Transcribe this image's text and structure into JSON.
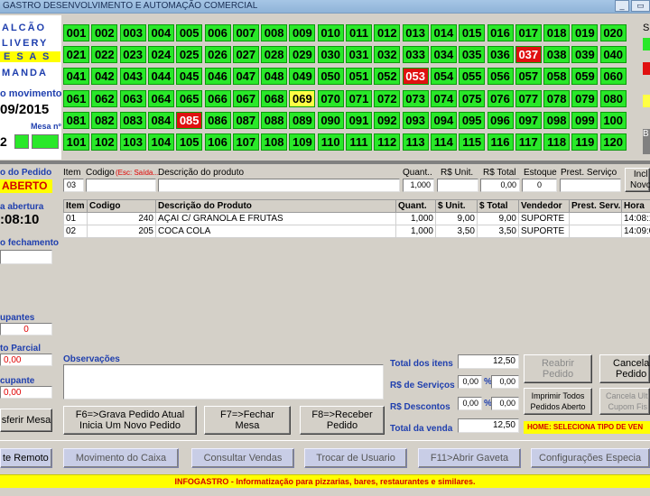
{
  "window": {
    "title": "GASTRO DESENVOLVIMENTO E AUTOMAÇÃO COMERCIAL",
    "minimize": "_"
  },
  "left_menu": {
    "balcao": "ALCÃO",
    "delivery": "LIVERY",
    "mesas": "E S A S",
    "comanda": "MANDA",
    "movimento_label": "o movimento",
    "movimento_date": "09/2015",
    "mesa_label": "Mesa nº",
    "mesa_value": "2"
  },
  "tables": [
    [
      "001",
      "002",
      "003",
      "004",
      "005",
      "006",
      "007",
      "008",
      "009",
      "010",
      "011",
      "012",
      "013",
      "014",
      "015",
      "016",
      "017",
      "018",
      "019",
      "020"
    ],
    [
      "021",
      "022",
      "023",
      "024",
      "025",
      "026",
      "027",
      "028",
      "029",
      "030",
      "031",
      "032",
      "033",
      "034",
      "035",
      "036",
      "037",
      "038",
      "039",
      "040"
    ],
    [
      "041",
      "042",
      "043",
      "044",
      "045",
      "046",
      "047",
      "048",
      "049",
      "050",
      "051",
      "052",
      "053",
      "054",
      "055",
      "056",
      "057",
      "058",
      "059",
      "060"
    ],
    [
      "061",
      "062",
      "063",
      "064",
      "065",
      "066",
      "067",
      "068",
      "069",
      "070",
      "071",
      "072",
      "073",
      "074",
      "075",
      "076",
      "077",
      "078",
      "079",
      "080"
    ],
    [
      "081",
      "082",
      "083",
      "084",
      "085",
      "086",
      "087",
      "088",
      "089",
      "090",
      "091",
      "092",
      "093",
      "094",
      "095",
      "096",
      "097",
      "098",
      "099",
      "100"
    ],
    [
      "101",
      "102",
      "103",
      "104",
      "105",
      "106",
      "107",
      "108",
      "109",
      "110",
      "111",
      "112",
      "113",
      "114",
      "115",
      "116",
      "117",
      "118",
      "119",
      "120"
    ]
  ],
  "table_status": {
    "red": [
      "037",
      "053",
      "085"
    ],
    "yellow": [
      "069"
    ]
  },
  "right_partial": {
    "s": "S",
    "b": "B",
    "e": "e"
  },
  "order_panel": {
    "status_label": "o do Pedido",
    "status_value": "ABERTO",
    "abertura_label": "a abertura",
    "abertura_time": ":08:10",
    "fechamento_label": "o fechamento",
    "ocupantes_label": "upantes",
    "ocupantes_value": "0",
    "parcial_label": "to Parcial",
    "parcial_value": "0,00",
    "por_ocupante_label": "cupante",
    "por_ocupante_value": "0,00",
    "transferir_button": "sferir Mesa"
  },
  "entry": {
    "item_label": "Item",
    "codigo_label": "Codigo",
    "codigo_hint": "(Esc: Saída...",
    "descricao_label": "Descrição do produto",
    "quant_label": "Quant..",
    "unit_label": "R$ Unit.",
    "total_label": "R$ Total",
    "estoque_label": "Estoque",
    "prest_label": "Prest. Serviço",
    "item_value": "03",
    "quant_value": "1,000",
    "unit_value": "",
    "total_value": "0,00",
    "estoque_value": "0",
    "incluir_button": "Incl\nNovo"
  },
  "items_table": {
    "headers": [
      "Item",
      "Codigo",
      "Descrição do Produto",
      "Quant.",
      "$ Unit.",
      "$ Total",
      "Vendedor",
      "Prest. Serv.",
      "Hora"
    ],
    "rows": [
      [
        "01",
        "240",
        "AÇAI C/ GRANOLA E FRUTAS",
        "1,000",
        "9,00",
        "9,00",
        "SUPORTE",
        "",
        "14:08:1"
      ],
      [
        "02",
        "205",
        "COCA COLA",
        "1,000",
        "3,50",
        "3,50",
        "SUPORTE",
        "",
        "14:09:0"
      ]
    ]
  },
  "observacoes_label": "Observações",
  "totals": {
    "itens_label": "Total  dos itens",
    "itens_value": "12,50",
    "servicos_label": "R$ de Serviços",
    "servicos_value": "0,00",
    "servicos_pct": "0,00",
    "descontos_label": "R$   Descontos",
    "descontos_value": "0,00",
    "descontos_pct": "0,00",
    "percent_sign": "%",
    "venda_label": "Total da venda",
    "venda_value": "12,50"
  },
  "actions": {
    "f6": "F6=>Grava Pedido Atual\nInicia Um Novo Pedido",
    "f7": "F7=>Fechar\nMesa",
    "f8": "F8=>Receber\nPedido",
    "reabrir": "Reabrir\nPedido",
    "cancelar": "Cancela\nPedido",
    "imprimir": "Imprimir Todos\nPedidos Aberto",
    "cancela_ultimo": "Cancela Ulti\nCupom Fis",
    "home_hint": "HOME: SELECIONA TIPO DE VEN"
  },
  "toolbar": {
    "remoto": "te Remoto",
    "movimento_caixa": "Movimento do Caixa",
    "consultar_vendas": "Consultar Vendas",
    "trocar_usuario": "Trocar de Usuario",
    "abrir_gaveta": "F11>Abrir Gaveta",
    "configuracoes": "Configurações Especia"
  },
  "status_bar": "INFOGASTRO - Informatização para pizzarias, bares, restaurantes e similares."
}
